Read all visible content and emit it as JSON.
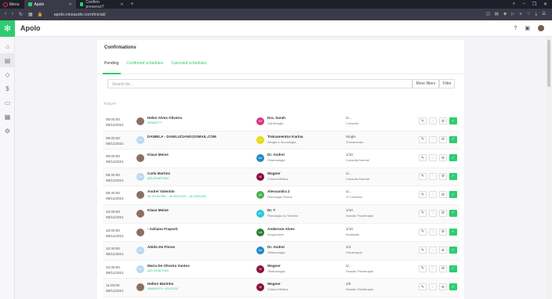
{
  "browser": {
    "menu_label": "Menu",
    "tabs": [
      {
        "label": "Apolo"
      },
      {
        "label": "Confirm presence?"
      }
    ],
    "url": "apolo.ninsaude.com/inicial/"
  },
  "app": {
    "title": "Apolo"
  },
  "page": {
    "title": "Confirmations",
    "tabs": [
      "Pending",
      "Confirmed schedules",
      "Canceled schedules"
    ],
    "search_placeholder": "Search for...",
    "more_filters": "More filters",
    "filter": "Filter",
    "section_label": "TODAY"
  },
  "colors": {
    "accent": "#2ecc71"
  },
  "rows": [
    {
      "time": "08:00:00",
      "date": "08/11/2021",
      "patient": "Helen Alves Oliveira",
      "phone": "999882777",
      "p_initials": "",
      "doctor": "Dra. Sarah",
      "doctor_initials": "DS",
      "doctor_color": "#d63384",
      "specialty": "Cardiologia",
      "session": "1/...",
      "session_desc": "Consulta"
    },
    {
      "time": "09:00:00",
      "date": "08/11/2021",
      "patient": "DANIELA - DANILUCIANO@GMAIL.COM",
      "phone": "",
      "p_initials": "DD",
      "doctor": "Treinamentos Karina",
      "doctor_initials": "TK",
      "doctor_color": "#e8d90a",
      "specialty": "Alergia e Imunologia",
      "session": "Single",
      "session_desc": "Treinamento"
    },
    {
      "time": "09:00:00",
      "date": "08/11/2021",
      "patient": "Klaus Meine",
      "phone": "",
      "p_initials": "",
      "doctor": "Dr. Andrei",
      "doctor_initials": "DA",
      "doctor_color": "#1e88c8",
      "specialty": "Oftalmologia",
      "session": "1/10",
      "session_desc": "Consulta Normal"
    },
    {
      "time": "09:30:00",
      "date": "08/11/2021",
      "patient": "Carla Martins",
      "phone": "(48) 991607564",
      "p_initials": "CM",
      "doctor": "Wagner",
      "doctor_initials": "W",
      "doctor_color": "#8a1040",
      "specialty": "Clínica Médica",
      "session": "1/...",
      "session_desc": "Consulta Normal"
    },
    {
      "time": "09:40:00",
      "date": "08/11/2021",
      "patient": "Andrei Valentim",
      "phone": "48 991607564 - 48 30237097 - 48 33921900",
      "p_initials": "",
      "doctor": "Alessandra 2",
      "doctor_initials": "A2",
      "doctor_color": "#4caf50",
      "specialty": "Psicologia Clinica",
      "session": "1/...",
      "session_desc": "1ª Consulta"
    },
    {
      "time": "10:00:00",
      "date": "08/11/2021",
      "patient": "Klaus Meine",
      "phone": "",
      "p_initials": "",
      "doctor": "Dr. T",
      "doctor_initials": "DT",
      "doctor_color": "#26c6da",
      "specialty": "Psicologia do Trânsito",
      "session": "1/10",
      "session_desc": "Sessão Fisioterapia"
    },
    {
      "time": "10:00:00",
      "date": "08/11/2021",
      "patient": "- Adriano Fraporti",
      "phone": "",
      "p_initials": "",
      "doctor": "Anderson Alves",
      "doctor_initials": "AA",
      "doctor_color": "#2e7d32",
      "specialty": "Acupuntura",
      "session": "1/10",
      "session_desc": "Avaliação"
    },
    {
      "time": "10:30:00",
      "date": "08/11/2021",
      "patient": "Abido De Flores",
      "phone": "",
      "p_initials": "AD",
      "doctor": "Dr. Andrei",
      "doctor_initials": "DA",
      "doctor_color": "#1e88c8",
      "specialty": "Oftalmologia",
      "session": "1/4",
      "session_desc": "Fisioterapia"
    },
    {
      "time": "10:30:00",
      "date": "08/11/2021",
      "patient": "Maria De Oliveira Santos",
      "phone": "(48) 991607564",
      "p_initials": "MS",
      "doctor": "Wagner",
      "doctor_initials": "W",
      "doctor_color": "#8a1040",
      "specialty": "Oftalmologia",
      "session": "1/...",
      "session_desc": "Sessão Fisioterapia"
    },
    {
      "time": "11:00:00",
      "date": "08/11/2021",
      "patient": "Helton Marinho",
      "phone": "996661979 • 32121212",
      "p_initials": "",
      "doctor": "Wagner",
      "doctor_initials": "W",
      "doctor_color": "#8a1040",
      "specialty": "Clínica Médica",
      "session": "1/6",
      "session_desc": "Sessão Fisioterapia"
    }
  ]
}
